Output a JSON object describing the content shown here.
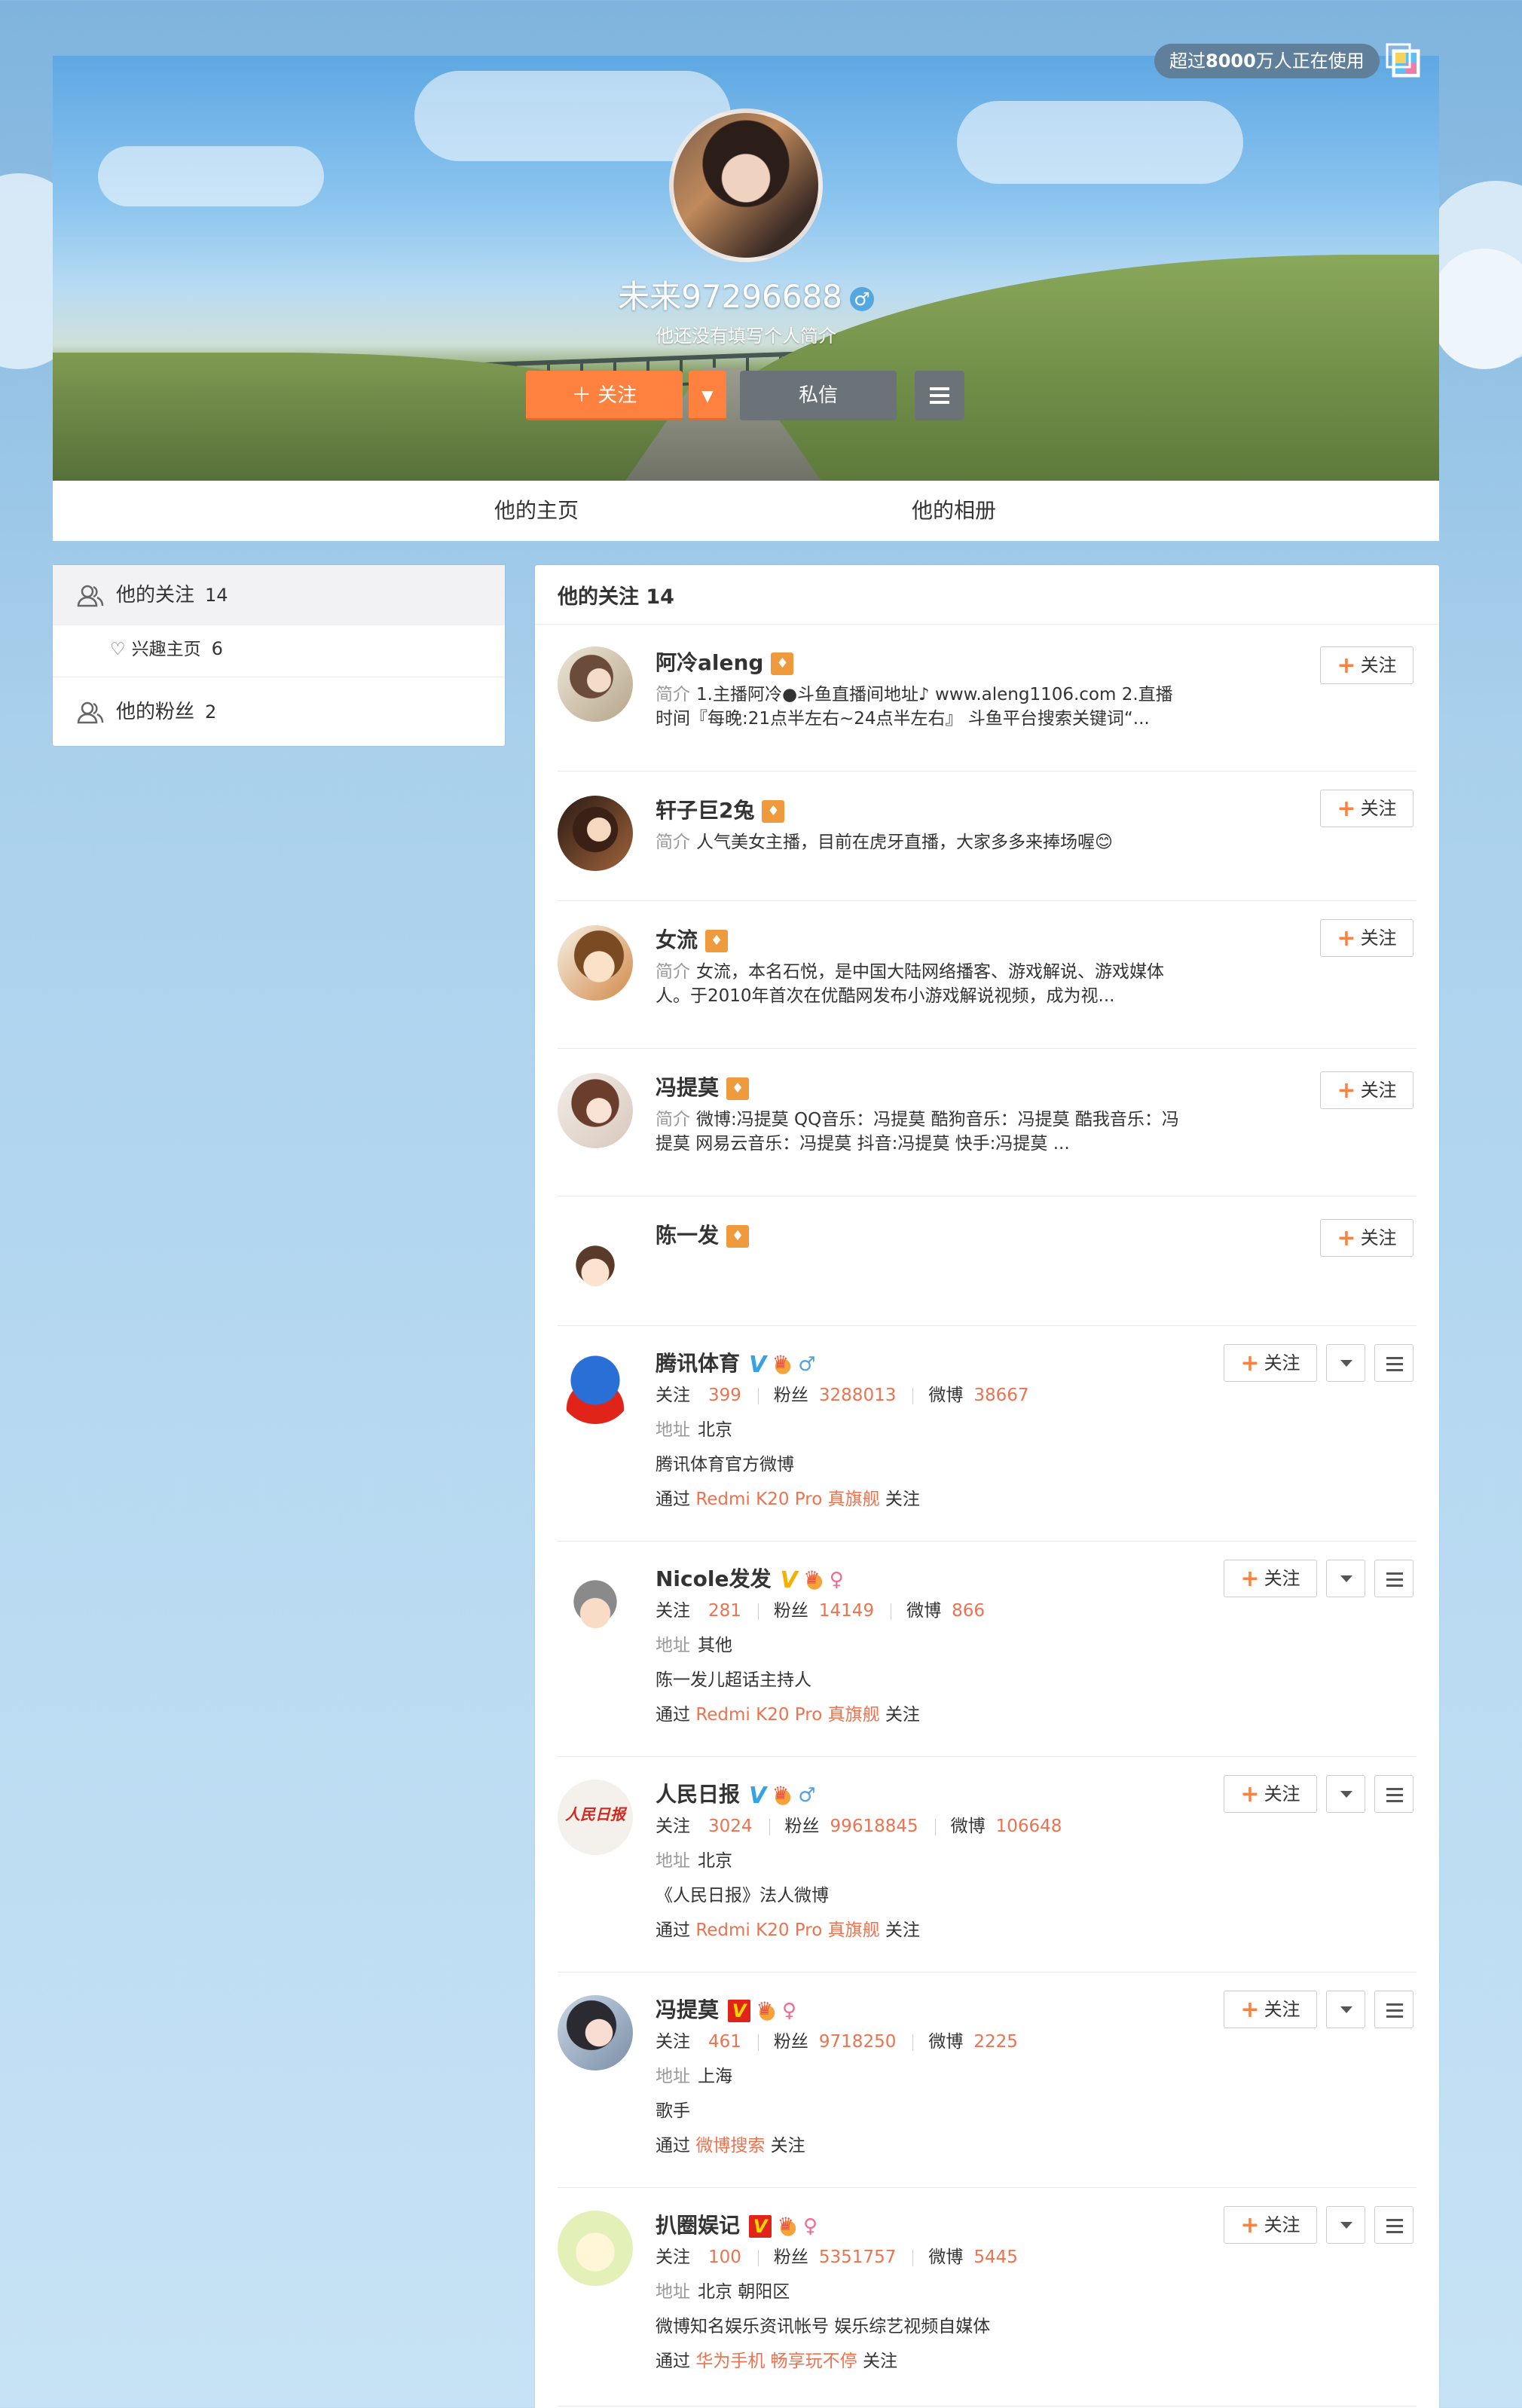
{
  "top": {
    "users_badge_prefix": "超过",
    "users_badge_num": "8000",
    "users_badge_suffix": "万人正在使用"
  },
  "profile": {
    "name": "未来97296688",
    "gender_icon": "male-icon",
    "intro": "他还没有填写个人简介",
    "follow_label": "关注",
    "message_label": "私信"
  },
  "tabs": [
    "他的主页",
    "他的相册"
  ],
  "sidebar": {
    "following_label": "他的关注",
    "following_count": "14",
    "interest_label": "兴趣主页",
    "interest_count": "6",
    "fans_label": "他的粉丝",
    "fans_count": "2"
  },
  "main": {
    "title": "他的关注 14",
    "follow_label": "关注",
    "intro_label": "简介",
    "stat_labels": {
      "following": "关注",
      "fans": "粉丝",
      "weibo": "微博",
      "address": "地址",
      "via": "通过",
      "via_suffix": "关注"
    },
    "simple_items": [
      {
        "name": "阿冷aleng",
        "intro": "1.主播阿冷●斗鱼直播间地址♪ www.aleng1106.com 2.直播时间『每晚:21点半左右~24点半左右』 斗鱼平台搜索关键词“..."
      },
      {
        "name": "轩子巨2兔",
        "intro": "人气美女主播，目前在虎牙直播，大家多多来捧场喔😊"
      },
      {
        "name": "女流",
        "intro": "女流，本名石悦，是中国大陆网络播客、游戏解说、游戏媒体人。于2010年首次在优酷网发布小游戏解说视频，成为视..."
      },
      {
        "name": "冯提莫",
        "intro": "微博:冯提莫 QQ音乐：冯提莫 酷狗音乐：冯提莫 酷我音乐：冯提莫 网易云音乐：冯提莫 抖音:冯提莫 快手:冯提莫 ..."
      },
      {
        "name": "陈一发",
        "intro": ""
      }
    ],
    "detail_items": [
      {
        "name": "腾讯体育",
        "verify": "V",
        "verify_color": "#37a3e6",
        "gender": "♂",
        "following": "399",
        "fans": "3288013",
        "weibo": "38667",
        "address": "北京",
        "desc": "腾讯体育官方微博",
        "via": "Redmi K20 Pro 真旗舰"
      },
      {
        "name": "Nicole发发",
        "verify": "V",
        "verify_color": "#f6b100",
        "gender": "♀",
        "following": "281",
        "fans": "14149",
        "weibo": "866",
        "address": "其他",
        "desc": "陈一发儿超话主持人",
        "via": "Redmi K20 Pro 真旗舰"
      },
      {
        "name": "人民日报",
        "verify": "V",
        "verify_color": "#37a3e6",
        "gender": "♂",
        "following": "3024",
        "fans": "99618845",
        "weibo": "106648",
        "address": "北京",
        "desc": "《人民日报》法人微博",
        "via": "Redmi K20 Pro 真旗舰"
      },
      {
        "name": "冯提莫",
        "verify": "V",
        "verify_color": "#e0241a",
        "gender": "♀",
        "following": "461",
        "fans": "9718250",
        "weibo": "2225",
        "address": "上海",
        "desc": "歌手",
        "via": "微博搜索"
      },
      {
        "name": "扒圈娱记",
        "verify": "V",
        "verify_color": "#e0241a",
        "gender": "♀",
        "following": "100",
        "fans": "5351757",
        "weibo": "5445",
        "address": "北京 朝阳区",
        "desc": "微博知名娱乐资讯帐号 娱乐综艺视频自媒体",
        "via": "华为手机 畅享玩不停"
      }
    ]
  }
}
